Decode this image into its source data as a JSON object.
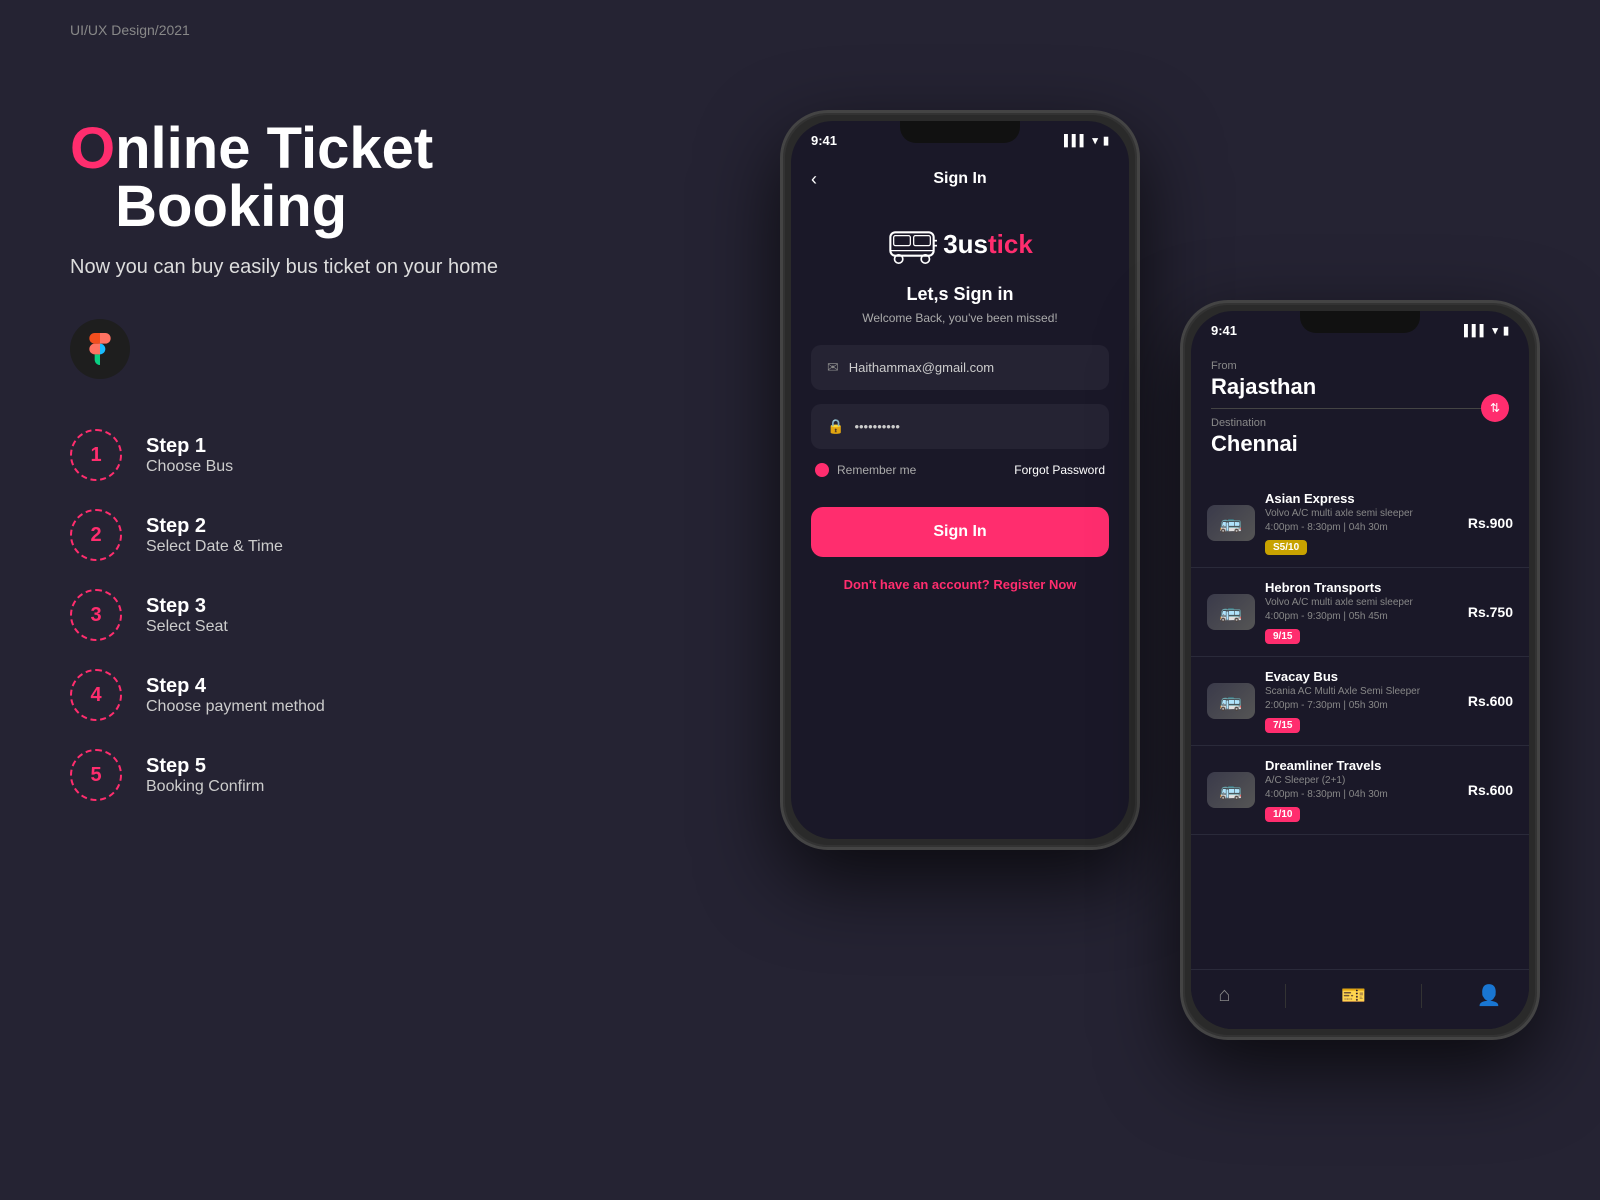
{
  "watermark": "UI/UX Design/2021",
  "title": {
    "letter_o": "O",
    "rest": "nline Ticket Booking"
  },
  "subtitle": "Now you can buy easily bus ticket on your home",
  "steps": [
    {
      "number": "1",
      "title": "Step 1",
      "desc": "Choose Bus"
    },
    {
      "number": "2",
      "title": "Step 2",
      "desc": "Select Date & Time"
    },
    {
      "number": "3",
      "title": "Step 3",
      "desc": "Select Seat"
    },
    {
      "number": "4",
      "title": "Step 4",
      "desc": "Choose payment method"
    },
    {
      "number": "5",
      "title": "Step 5",
      "desc": "Booking Confirm"
    }
  ],
  "phone1": {
    "time": "9:41",
    "screen_title": "Sign In",
    "logo_text_white": "3us",
    "logo_text_pink": "tick",
    "welcome_heading": "Let,s Sign in",
    "welcome_sub": "Welcome Back, you've been missed!",
    "email_placeholder": "Haithammax@gmail.com",
    "password_placeholder": "••••••••••",
    "remember_label": "Remember me",
    "forgot_label": "Forgot Password",
    "signin_btn": "Sign In",
    "no_account": "Don't have an account?",
    "register_link": "Register Now"
  },
  "phone2": {
    "time": "9:41",
    "from_label": "From",
    "from_city": "Rajasthan",
    "dest_label": "Destination",
    "dest_city": "Chennai",
    "buses": [
      {
        "name": "Asian Express",
        "type": "Volvo A/C multi axle semi sleeper",
        "time": "4:00pm - 8:30pm | 04h 30m",
        "seats": "S5/10",
        "badge_color": "badge-yellow",
        "price": "Rs.900"
      },
      {
        "name": "Hebron Transports",
        "type": "Volvo A/C multi axle semi sleeper",
        "time": "4:00pm - 9:30pm | 05h 45m",
        "seats": "9/15",
        "badge_color": "badge-pink",
        "price": "Rs.750"
      },
      {
        "name": "Evacay Bus",
        "type": "Scania AC Multi Axle Semi Sleeper",
        "time": "2:00pm - 7:30pm | 05h 30m",
        "seats": "7/15",
        "badge_color": "badge-pink",
        "price": "Rs.600"
      },
      {
        "name": "Dreamliner Travels",
        "type": "A/C Sleeper (2+1)",
        "time": "4:00pm - 8:30pm | 04h 30m",
        "seats": "1/10",
        "badge_color": "badge-pink",
        "price": "Rs.600"
      }
    ]
  },
  "colors": {
    "bg": "#252333",
    "accent": "#ff2d6e",
    "text_white": "#ffffff",
    "text_gray": "#888888"
  }
}
